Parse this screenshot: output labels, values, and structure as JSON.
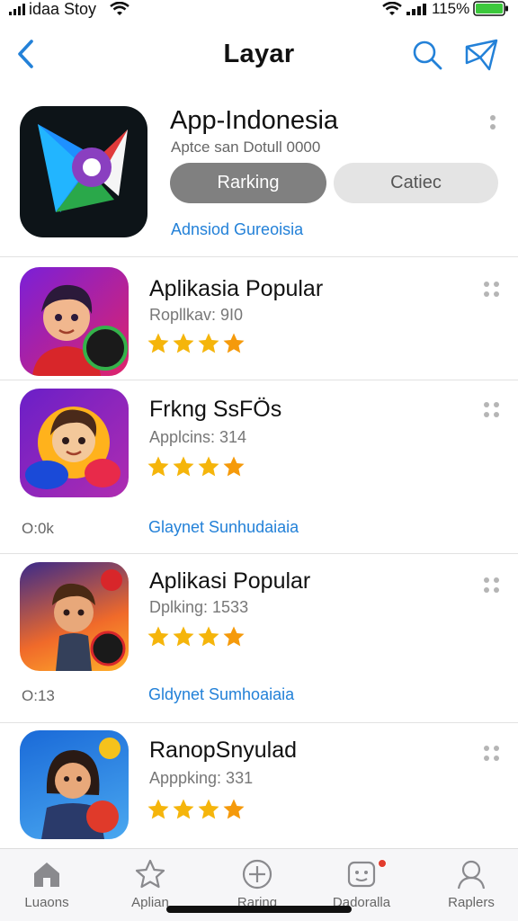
{
  "status_bar": {
    "carrier": "idaa Stoy",
    "battery": "115%"
  },
  "header": {
    "title": "Layar"
  },
  "featured": {
    "title": "App-Indonesia",
    "subtitle": "Aptce san Dotull 0000",
    "primary_button": "Rarking",
    "secondary_button": "Catiec",
    "links": "Adnsiod  Gureoisia"
  },
  "apps": [
    {
      "title": "Aplikasia Popular",
      "subtitle": "Ropllkav: 9I0",
      "rating": 4
    },
    {
      "title": "Frkng SsFÖs",
      "subtitle": "Applcins: 314",
      "rating": 4,
      "meta": "O:0k",
      "links": "Glaynet  Sunhudaiaia"
    },
    {
      "title": "Aplikasi Popular",
      "subtitle": "Dplking: 1533",
      "rating": 4,
      "meta": "O:13",
      "links": "Gldynet  Sumhoaiaia"
    },
    {
      "title": "RanopSnyulad",
      "subtitle": "Apppking: 331",
      "rating": 4
    }
  ],
  "tabs": [
    {
      "label": "Luaons",
      "icon": "home-icon"
    },
    {
      "label": "Aplian",
      "icon": "star-icon"
    },
    {
      "label": "Raring",
      "icon": "compass-icon"
    },
    {
      "label": "Dadoralla",
      "icon": "face-icon"
    },
    {
      "label": "Raplers",
      "icon": "profile-icon"
    }
  ],
  "colors": {
    "accent": "#2381d8",
    "star": "#f5b50b",
    "primary_button": "#808080",
    "secondary_button": "#e4e4e4",
    "badge": "#e23c2e"
  }
}
